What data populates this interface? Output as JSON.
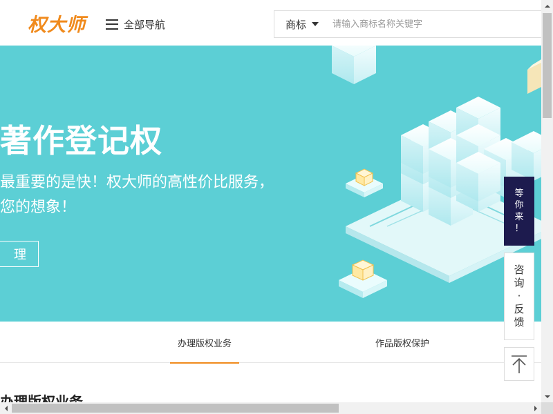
{
  "header": {
    "logo_text": "权大师",
    "nav_toggle_label": "全部导航",
    "search": {
      "type_selected": "商标",
      "placeholder": "请输入商标名称关键字",
      "value": ""
    }
  },
  "banner": {
    "title": "著作登记权",
    "subtitle_line1": "最重要的是快！权大师的高性价比服务，",
    "subtitle_line2": "您的想象！",
    "button_label": "理",
    "background_color": "#5ccfd5",
    "illustration": "isometric-cubes-illustration"
  },
  "tabs": [
    {
      "label": "办理版权业务",
      "active": true
    },
    {
      "label": "作品版权保护",
      "active": false
    }
  ],
  "section_heading": "办理版权业务",
  "side_widgets": {
    "wait_lines": [
      "等",
      "你",
      "来",
      "！"
    ],
    "consult_lines": [
      "咨",
      "询",
      "·",
      "反",
      "馈"
    ],
    "back_to_top_icon": "arrow-up-to-top-icon"
  },
  "colors": {
    "brand_orange": "#f08a1c",
    "navy": "#1d1b4e"
  }
}
